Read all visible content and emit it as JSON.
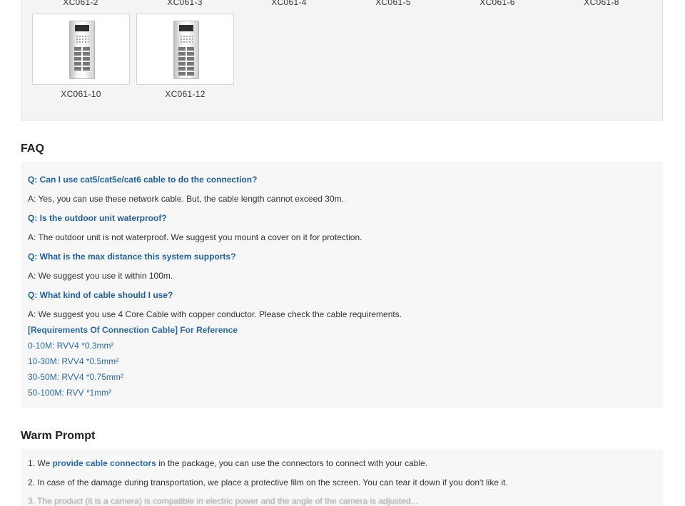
{
  "models": {
    "top_row": [
      "XC061-2",
      "XC061-3",
      "XC061-4",
      "XC061-5",
      "XC061-6",
      "XC061-8"
    ],
    "bottom_row": [
      {
        "label": "XC061-10",
        "image": "door-station-icon"
      },
      {
        "label": "XC061-12",
        "image": "door-station-icon"
      }
    ]
  },
  "faq": {
    "title": "FAQ",
    "items": [
      {
        "q": "Q:  Can I use cat5/cat5e/cat6 cable to do the connection?",
        "a": "A: Yes, you can use these network cable. But, the cable length cannot exceed 30m."
      },
      {
        "q": "Q:  Is the outdoor unit waterproof?",
        "a": "A:  The outdoor unit is not waterproof. We suggest you mount a cover on it for protection."
      },
      {
        "q": "Q:  What is the max distance this system supports?",
        "a": "A: We suggest you use it within 100m."
      },
      {
        "q": "Q: What kind of cable should I use?",
        "a": "A: We suggest you use 4 Core Cable with copper conductor. Please check the cable requirements."
      }
    ],
    "requirements_title": "[Requirements Of Connection Cable] For Reference",
    "requirements": [
      "0-10M: RVV4 *0.3mm²",
      "10-30M: RVV4 *0.5mm²",
      "30-50M: RVV4 *0.75mm²",
      "50-100M: RVV *1mm²"
    ]
  },
  "warm_prompt": {
    "title": "Warm Prompt",
    "line1_pre": "1. We ",
    "line1_link": "provide cable connectors",
    "line1_post": " in the package, you can use the connectors to connect with your cable.",
    "line2": "2. In case of the damage during transportation, we place a protective film on the screen. You can tear it down if you don't like it.",
    "line3": "3. The product (it is a camera)  is compatible in electric power and the angle of the camera is adjusted..."
  }
}
